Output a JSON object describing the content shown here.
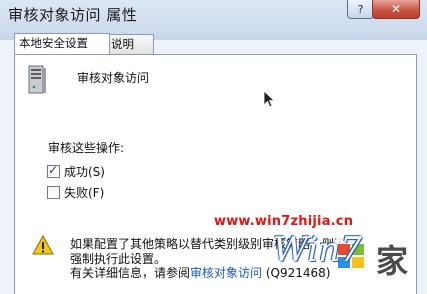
{
  "window": {
    "title": "审核对象访问 属性",
    "help_label": "?",
    "close_label": "✕"
  },
  "tabs": [
    {
      "label": "本地安全设置",
      "active": true
    },
    {
      "label": "说明",
      "active": false
    }
  ],
  "policy": {
    "name": "审核对象访问",
    "icon": "server-icon"
  },
  "operations": {
    "label": "审核这些操作:",
    "options": [
      {
        "label": "成功(S)",
        "checked": true
      },
      {
        "label": "失败(F)",
        "checked": false
      }
    ]
  },
  "note": {
    "icon": "warning-icon",
    "line1": "如果配置了其他策略以替代类别级别审核策略，则",
    "line1_tail": "不会",
    "line2": "强制执行此设置。",
    "line3_prefix": "有关详细信息，请参阅",
    "link": "审核对象访问",
    "kb": "(Q921468)"
  },
  "watermark": {
    "url": "www.win7zhijia.cn",
    "logo_text": "Win7",
    "logo_suffix": "家"
  },
  "colors": {
    "link": "#1a55c9",
    "watermark_red": "#e11414",
    "close_red": "#c6513f"
  }
}
